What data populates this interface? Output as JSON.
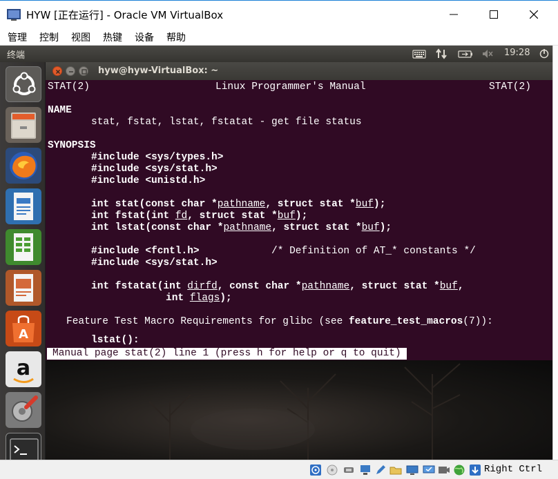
{
  "window": {
    "title": "HYW [正在运行] - Oracle VM VirtualBox",
    "minimize": "─",
    "maximize": "☐",
    "close": "✕"
  },
  "menu": [
    "管理",
    "控制",
    "视图",
    "热键",
    "设备",
    "帮助"
  ],
  "panel": {
    "title": "终端",
    "time": "19:28"
  },
  "launcher": [
    {
      "name": "dash-home",
      "icon": "ubuntu-logo-icon"
    },
    {
      "name": "files",
      "icon": "file-cabinet-icon"
    },
    {
      "name": "firefox",
      "icon": "firefox-icon"
    },
    {
      "name": "libreoffice-writer",
      "icon": "writer-document-icon"
    },
    {
      "name": "libreoffice-calc",
      "icon": "calc-spreadsheet-icon"
    },
    {
      "name": "libreoffice-impress",
      "icon": "impress-presentation-icon"
    },
    {
      "name": "ubuntu-software",
      "icon": "software-center-bag-icon"
    },
    {
      "name": "amazon",
      "icon": "amazon-icon"
    },
    {
      "name": "system-settings",
      "icon": "settings-wrench-icon"
    },
    {
      "name": "terminal",
      "icon": "terminal-icon"
    }
  ],
  "terminal": {
    "title": "hyw@hyw-VirtualBox: ~",
    "lines": {
      "header_left": "STAT(2)",
      "header_mid": "Linux Programmer's Manual",
      "header_right": "STAT(2)",
      "name_heading": "NAME",
      "name_text": "stat, fstat, lstat, fstatat - get file status",
      "synopsis_heading": "SYNOPSIS",
      "inc1": "#include <sys/types.h>",
      "inc2": "#include <sys/stat.h>",
      "inc3": "#include <unistd.h>",
      "stat_pre": "int stat(const char *",
      "stat_arg1": "pathname",
      "stat_mid": ", struct stat *",
      "stat_arg2": "buf",
      "stat_post": ");",
      "fstat_pre": "int fstat(int ",
      "fstat_arg1": "fd",
      "fstat_mid": ", struct stat *",
      "fstat_arg2": "buf",
      "fstat_post": ");",
      "lstat_pre": "int lstat(const char *",
      "lstat_arg1": "pathname",
      "lstat_mid": ", struct stat *",
      "lstat_arg2": "buf",
      "lstat_post": ");",
      "inc4": "#include <fcntl.h>",
      "inc4_comment": "/* Definition of AT_* constants */",
      "inc5": "#include <sys/stat.h>",
      "fstatat_pre": "int fstatat(int ",
      "fstatat_arg1": "dirfd",
      "fstatat_mid1": ", const char *",
      "fstatat_arg2": "pathname",
      "fstatat_mid2": ", struct stat *",
      "fstatat_arg3": "buf",
      "fstatat_end1": ",",
      "fstatat_pre2": "int ",
      "fstatat_arg4": "flags",
      "fstatat_post": ");",
      "ftm_pre": "Feature Test Macro Requirements for glibc (see ",
      "ftm_bold": "feature_test_macros",
      "ftm_post": "(7)):",
      "lstat_req": "lstat():"
    },
    "status_line": "Manual page stat(2) line 1 (press h for help or q to quit)"
  },
  "statusbar": {
    "host_key": "Right Ctrl",
    "icons": [
      "optical-drive-icon",
      "audio-icon",
      "usb-icon",
      "network-icon",
      "shared-folder-icon",
      "pen-icon",
      "display-icon",
      "monitor-icon",
      "recording-icon",
      "green-globe-icon",
      "mouse-integration-arrow-icon"
    ]
  },
  "colors": {
    "terminal_bg": "#300a24",
    "panel_bg": "#3c3b37",
    "launcher_bg": "#343231"
  }
}
